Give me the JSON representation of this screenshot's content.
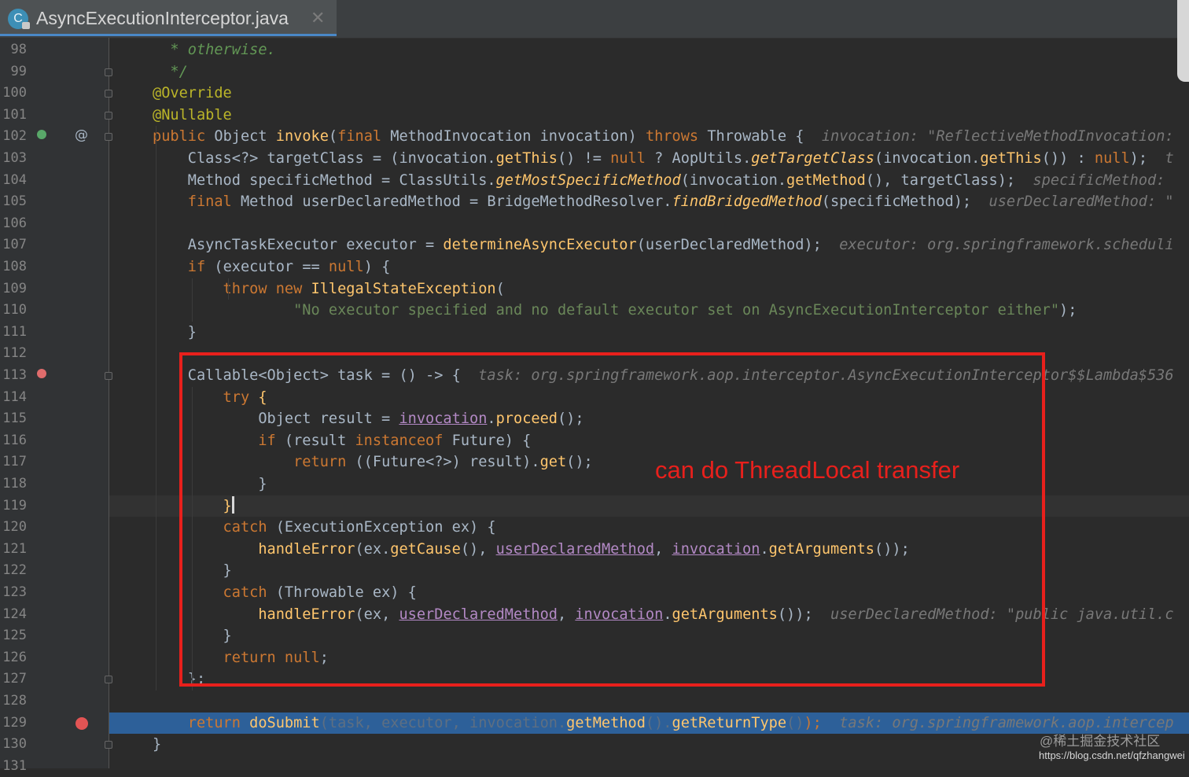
{
  "tab": {
    "title": "AsyncExecutionInterceptor.java",
    "icon_letter": "C",
    "close_glyph": "✕"
  },
  "gutter": {
    "override_marker": "@"
  },
  "lines": [
    {
      "n": "98",
      "t": [
        {
          "c": "cm",
          "v": "  * otherwise."
        }
      ]
    },
    {
      "n": "99",
      "t": [
        {
          "c": "cm",
          "v": "  */"
        }
      ]
    },
    {
      "n": "100",
      "t": [
        {
          "c": "a",
          "v": "@Override"
        }
      ]
    },
    {
      "n": "101",
      "t": [
        {
          "c": "a",
          "v": "@Nullable"
        }
      ]
    },
    {
      "n": "102",
      "t": [
        {
          "c": "k",
          "v": "public "
        },
        {
          "c": "p",
          "v": "Object "
        },
        {
          "c": "f",
          "v": "invoke"
        },
        {
          "c": "p",
          "v": "("
        },
        {
          "c": "k",
          "v": "final "
        },
        {
          "c": "p",
          "v": "MethodInvocation invocation) "
        },
        {
          "c": "k",
          "v": "throws "
        },
        {
          "c": "p",
          "v": "Throwable {  "
        },
        {
          "c": "i",
          "v": "invocation: \"ReflectiveMethodInvocation:"
        }
      ]
    },
    {
      "n": "103",
      "t": [
        {
          "c": "p",
          "v": "    Class<?> targetClass = (invocation."
        },
        {
          "c": "f",
          "v": "getThis"
        },
        {
          "c": "p",
          "v": "() != "
        },
        {
          "c": "k",
          "v": "null "
        },
        {
          "c": "p",
          "v": "? AopUtils."
        },
        {
          "c": "fi",
          "v": "getTargetClass"
        },
        {
          "c": "p",
          "v": "(invocation."
        },
        {
          "c": "f",
          "v": "getThis"
        },
        {
          "c": "p",
          "v": "()) : "
        },
        {
          "c": "k",
          "v": "null"
        },
        {
          "c": "p",
          "v": ");  "
        },
        {
          "c": "i",
          "v": "t"
        }
      ]
    },
    {
      "n": "104",
      "t": [
        {
          "c": "p",
          "v": "    Method specificMethod = ClassUtils."
        },
        {
          "c": "fi",
          "v": "getMostSpecificMethod"
        },
        {
          "c": "p",
          "v": "(invocation."
        },
        {
          "c": "f",
          "v": "getMethod"
        },
        {
          "c": "p",
          "v": "(), targetClass);  "
        },
        {
          "c": "i",
          "v": "specificMethod:"
        }
      ]
    },
    {
      "n": "105",
      "t": [
        {
          "c": "k",
          "v": "    final "
        },
        {
          "c": "p",
          "v": "Method userDeclaredMethod = BridgeMethodResolver."
        },
        {
          "c": "fi",
          "v": "findBridgedMethod"
        },
        {
          "c": "p",
          "v": "(specificMethod);  "
        },
        {
          "c": "i",
          "v": "userDeclaredMethod: \""
        }
      ]
    },
    {
      "n": "106",
      "t": []
    },
    {
      "n": "107",
      "t": [
        {
          "c": "p",
          "v": "    AsyncTaskExecutor executor = "
        },
        {
          "c": "f",
          "v": "determineAsyncExecutor"
        },
        {
          "c": "p",
          "v": "(userDeclaredMethod);  "
        },
        {
          "c": "i",
          "v": "executor: org.springframework.scheduli"
        }
      ]
    },
    {
      "n": "108",
      "t": [
        {
          "c": "k",
          "v": "    if "
        },
        {
          "c": "p",
          "v": "(executor == "
        },
        {
          "c": "k",
          "v": "null"
        },
        {
          "c": "p",
          "v": ") {"
        }
      ]
    },
    {
      "n": "109",
      "t": [
        {
          "c": "k",
          "v": "        throw new "
        },
        {
          "c": "f",
          "v": "IllegalStateException"
        },
        {
          "c": "p",
          "v": "("
        }
      ]
    },
    {
      "n": "110",
      "t": [
        {
          "c": "s",
          "v": "                \"No executor specified and no default executor set on AsyncExecutionInterceptor either\""
        },
        {
          "c": "p",
          "v": ");"
        }
      ]
    },
    {
      "n": "111",
      "t": [
        {
          "c": "p",
          "v": "    }"
        }
      ]
    },
    {
      "n": "112",
      "t": []
    },
    {
      "n": "113",
      "t": [
        {
          "c": "p",
          "v": "    Callable<Object> task = () -> {  "
        },
        {
          "c": "i",
          "v": "task: org.springframework.aop.interceptor.AsyncExecutionInterceptor$$Lambda$536"
        }
      ]
    },
    {
      "n": "114",
      "t": [
        {
          "c": "k",
          "v": "        try "
        },
        {
          "c": "f",
          "v": "{"
        }
      ]
    },
    {
      "n": "115",
      "t": [
        {
          "c": "p",
          "v": "            Object result = "
        },
        {
          "c": "u",
          "v": "invocation"
        },
        {
          "c": "p",
          "v": "."
        },
        {
          "c": "f",
          "v": "proceed"
        },
        {
          "c": "p",
          "v": "();"
        }
      ]
    },
    {
      "n": "116",
      "t": [
        {
          "c": "k",
          "v": "            if "
        },
        {
          "c": "p",
          "v": "(result "
        },
        {
          "c": "k",
          "v": "instanceof "
        },
        {
          "c": "p",
          "v": "Future) {"
        }
      ]
    },
    {
      "n": "117",
      "t": [
        {
          "c": "k",
          "v": "                return "
        },
        {
          "c": "p",
          "v": "((Future<?>) result)."
        },
        {
          "c": "f",
          "v": "get"
        },
        {
          "c": "p",
          "v": "();"
        }
      ]
    },
    {
      "n": "118",
      "t": [
        {
          "c": "p",
          "v": "            }"
        }
      ]
    },
    {
      "n": "119",
      "t": [
        {
          "c": "f",
          "v": "        }"
        }
      ],
      "cursor": true
    },
    {
      "n": "120",
      "t": [
        {
          "c": "k",
          "v": "        catch "
        },
        {
          "c": "p",
          "v": "(ExecutionException ex) {"
        }
      ]
    },
    {
      "n": "121",
      "t": [
        {
          "c": "f",
          "v": "            handleError"
        },
        {
          "c": "p",
          "v": "(ex."
        },
        {
          "c": "f",
          "v": "getCause"
        },
        {
          "c": "p",
          "v": "(), "
        },
        {
          "c": "u",
          "v": "userDeclaredMethod"
        },
        {
          "c": "p",
          "v": ", "
        },
        {
          "c": "u",
          "v": "invocation"
        },
        {
          "c": "p",
          "v": "."
        },
        {
          "c": "f",
          "v": "getArguments"
        },
        {
          "c": "p",
          "v": "());"
        }
      ]
    },
    {
      "n": "122",
      "t": [
        {
          "c": "p",
          "v": "        }"
        }
      ]
    },
    {
      "n": "123",
      "t": [
        {
          "c": "k",
          "v": "        catch "
        },
        {
          "c": "p",
          "v": "(Throwable ex) {"
        }
      ]
    },
    {
      "n": "124",
      "t": [
        {
          "c": "f",
          "v": "            handleError"
        },
        {
          "c": "p",
          "v": "(ex, "
        },
        {
          "c": "u",
          "v": "userDeclaredMethod"
        },
        {
          "c": "p",
          "v": ", "
        },
        {
          "c": "u",
          "v": "invocation"
        },
        {
          "c": "p",
          "v": "."
        },
        {
          "c": "f",
          "v": "getArguments"
        },
        {
          "c": "p",
          "v": "());  "
        },
        {
          "c": "i",
          "v": "userDeclaredMethod: \"public java.util.c"
        }
      ]
    },
    {
      "n": "125",
      "t": [
        {
          "c": "p",
          "v": "        }"
        }
      ]
    },
    {
      "n": "126",
      "t": [
        {
          "c": "k",
          "v": "        return null"
        },
        {
          "c": "p",
          "v": ";"
        }
      ]
    },
    {
      "n": "127",
      "t": [
        {
          "c": "p",
          "v": "    };"
        }
      ]
    },
    {
      "n": "128",
      "t": []
    },
    {
      "n": "129",
      "t": [
        {
          "c": "k",
          "v": "    return "
        },
        {
          "c": "f",
          "v": "doSubmit"
        },
        {
          "c": "d",
          "v": "(task, executor, invocation."
        },
        {
          "c": "f",
          "v": "getMethod"
        },
        {
          "c": "d",
          "v": "()."
        },
        {
          "c": "f",
          "v": "getReturnType"
        },
        {
          "c": "d",
          "v": "()"
        },
        {
          "c": "k",
          "v": ");  "
        },
        {
          "c": "i",
          "v": "task: org.springframework.aop.intercep"
        }
      ],
      "exec": true
    },
    {
      "n": "130",
      "t": [
        {
          "c": "p",
          "v": "}"
        }
      ]
    },
    {
      "n": "131",
      "t": []
    }
  ],
  "annotation": {
    "text": "can do ThreadLocal transfer",
    "color": "#e8201c"
  },
  "watermark": {
    "line1": "@稀土掘金技术社区",
    "line2": "https://blog.csdn.net/qfzhangwei"
  },
  "colors": {
    "keyword": "#cc7832",
    "annotation": "#bbb529",
    "string": "#6a8759",
    "method": "#ffc66d",
    "field": "#b389c5",
    "exec_line": "#2d6099"
  }
}
